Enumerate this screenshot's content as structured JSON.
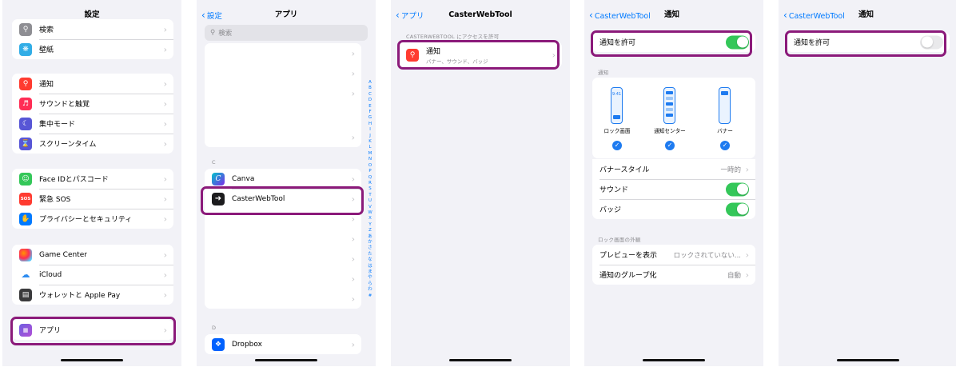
{
  "panel1": {
    "title": "設定",
    "group0": [
      "検索",
      "壁紙"
    ],
    "group1": [
      "通知",
      "サウンドと触覚",
      "集中モード",
      "スクリーンタイム"
    ],
    "group2": [
      "Face IDとパスコード",
      "緊急 SOS",
      "プライバシーとセキュリティ"
    ],
    "group3": [
      "Game Center",
      "iCloud",
      "ウォレットと Apple Pay"
    ],
    "apps": "アプリ",
    "sos_icon_text": "SOS"
  },
  "panel2": {
    "back": "設定",
    "title": "アプリ",
    "search_placeholder": "検索",
    "section_c": "C",
    "canva": "Canva",
    "caster": "CasterWebTool",
    "section_d": "D",
    "dropbox": "Dropbox",
    "index_letters": [
      "A",
      "B",
      "C",
      "D",
      "E",
      "F",
      "G",
      "H",
      "I",
      "J",
      "K",
      "L",
      "M",
      "N",
      "O",
      "P",
      "Q",
      "R",
      "S",
      "T",
      "U",
      "V",
      "W",
      "X",
      "Y",
      "Z",
      "あ",
      "か",
      "さ",
      "た",
      "な",
      "は",
      "ま",
      "や",
      "ら",
      "わ",
      "#"
    ]
  },
  "panel3": {
    "back": "アプリ",
    "title": "CasterWebTool",
    "section": "CASTERWEBTOOL にアクセスを許可",
    "notif_title": "通知",
    "notif_sub": "バナー、サウンド、バッジ"
  },
  "panel4": {
    "back": "CasterWebTool",
    "title": "通知",
    "allow": "通知を許可",
    "section_notif": "通知",
    "lock_time": "9:41",
    "styles": [
      "ロック画面",
      "通知センター",
      "バナー"
    ],
    "banner_style": "バナースタイル",
    "banner_style_value": "一時的",
    "sound": "サウンド",
    "badge": "バッジ",
    "section_lock": "ロック画面の外観",
    "preview": "プレビューを表示",
    "preview_value": "ロックされていない...",
    "grouping": "通知のグループ化",
    "grouping_value": "自動",
    "allow_on": true,
    "sound_on": true,
    "badge_on": true
  },
  "panel5": {
    "back": "CasterWebTool",
    "title": "通知",
    "allow": "通知を許可",
    "allow_on": false
  },
  "colors": {
    "highlight": "#8b1a7a",
    "ios_blue": "#007aff",
    "toggle_on": "#34c759",
    "toggle_off": "#e9e9eb",
    "notif_icon": "#ff3b30"
  }
}
